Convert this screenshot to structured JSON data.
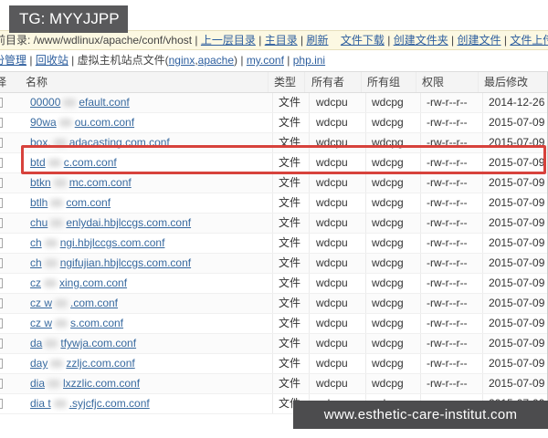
{
  "overlay_top": {
    "label": "TG: MYYJJPP"
  },
  "overlay_bottom": {
    "label": "www.esthetic-care-institut.com"
  },
  "colors": {
    "highlight_red": "#d7423c",
    "toolbar_beige": "#fcf8e2",
    "link_blue": "#2d5e9e",
    "file_link_blue": "#37699f",
    "overlay_gray": "#59595b"
  },
  "toolbar_path": {
    "parts": [
      {
        "text": "前目录: ",
        "link": false
      },
      {
        "text": "/www/wdlinux/apache/conf/vhost",
        "link": false
      },
      {
        "text": " | ",
        "link": false
      },
      {
        "text": "上一层目录",
        "link": true
      },
      {
        "text": " | ",
        "link": false
      },
      {
        "text": "主目录",
        "link": true
      },
      {
        "text": " | ",
        "link": false
      },
      {
        "text": "刷新",
        "link": true
      },
      {
        "text": "    ",
        "link": false
      },
      {
        "text": "文件下载",
        "link": true
      },
      {
        "text": " | ",
        "link": false
      },
      {
        "text": "创建文件夹",
        "link": true
      },
      {
        "text": " | ",
        "link": false
      },
      {
        "text": "创建文件",
        "link": true
      },
      {
        "text": " | ",
        "link": false
      },
      {
        "text": "文件上传",
        "link": true
      }
    ]
  },
  "toolbar_links": {
    "parts": [
      {
        "text": "份管理",
        "link": true
      },
      {
        "text": " | ",
        "link": false
      },
      {
        "text": "回收站",
        "link": true
      },
      {
        "text": " | ",
        "link": false
      },
      {
        "text": "虚拟主机站点文件(",
        "link": false
      },
      {
        "text": "nginx",
        "link": true
      },
      {
        "text": ",",
        "link": false
      },
      {
        "text": "apache",
        "link": true
      },
      {
        "text": ") | ",
        "link": false
      },
      {
        "text": "my.conf",
        "link": true
      },
      {
        "text": " | ",
        "link": false
      },
      {
        "text": "php.ini",
        "link": true
      }
    ]
  },
  "table": {
    "headers": [
      "择",
      "名称",
      "类型",
      "所有者",
      "所有组",
      "权限",
      "最后修改"
    ],
    "rows": [
      {
        "name_pre": "00000",
        "name_post": "efault.conf",
        "type": "文件",
        "owner": "wdcpu",
        "group": "wdcpg",
        "perm": "-rw-r--r--",
        "date": "2014-12-26",
        "highlighted": false
      },
      {
        "name_pre": "90wa",
        "name_post": "ou.com.conf",
        "type": "文件",
        "owner": "wdcpu",
        "group": "wdcpg",
        "perm": "-rw-r--r--",
        "date": "2015-07-09",
        "highlighted": false
      },
      {
        "name_pre": "box.",
        "name_post": "adacasting.com.conf",
        "type": "文件",
        "owner": "wdcpu",
        "group": "wdcpg",
        "perm": "-rw-r--r--",
        "date": "2015-07-09",
        "highlighted": false
      },
      {
        "name_pre": "btd",
        "name_post": "c.com.conf",
        "type": "文件",
        "owner": "wdcpu",
        "group": "wdcpg",
        "perm": "-rw-r--r--",
        "date": "2015-07-09",
        "highlighted": true
      },
      {
        "name_pre": "btkn",
        "name_post": "mc.com.conf",
        "type": "文件",
        "owner": "wdcpu",
        "group": "wdcpg",
        "perm": "-rw-r--r--",
        "date": "2015-07-09",
        "highlighted": false
      },
      {
        "name_pre": "btlh",
        "name_post": "com.conf",
        "type": "文件",
        "owner": "wdcpu",
        "group": "wdcpg",
        "perm": "-rw-r--r--",
        "date": "2015-07-09",
        "highlighted": false
      },
      {
        "name_pre": "chu",
        "name_post": "enlydai.hbjlccgs.com.conf",
        "type": "文件",
        "owner": "wdcpu",
        "group": "wdcpg",
        "perm": "-rw-r--r--",
        "date": "2015-07-09",
        "highlighted": false
      },
      {
        "name_pre": "ch",
        "name_post": "ngi.hbjlccgs.com.conf",
        "type": "文件",
        "owner": "wdcpu",
        "group": "wdcpg",
        "perm": "-rw-r--r--",
        "date": "2015-07-09",
        "highlighted": false
      },
      {
        "name_pre": "ch",
        "name_post": "ngifujian.hbjlccgs.com.conf",
        "type": "文件",
        "owner": "wdcpu",
        "group": "wdcpg",
        "perm": "-rw-r--r--",
        "date": "2015-07-09",
        "highlighted": false
      },
      {
        "name_pre": "cz",
        "name_post": "xing.com.conf",
        "type": "文件",
        "owner": "wdcpu",
        "group": "wdcpg",
        "perm": "-rw-r--r--",
        "date": "2015-07-09",
        "highlighted": false
      },
      {
        "name_pre": "cz w",
        "name_post": ".com.conf",
        "type": "文件",
        "owner": "wdcpu",
        "group": "wdcpg",
        "perm": "-rw-r--r--",
        "date": "2015-07-09",
        "highlighted": false
      },
      {
        "name_pre": "cz w",
        "name_post": "s.com.conf",
        "type": "文件",
        "owner": "wdcpu",
        "group": "wdcpg",
        "perm": "-rw-r--r--",
        "date": "2015-07-09",
        "highlighted": false
      },
      {
        "name_pre": "da",
        "name_post": "tfywja.com.conf",
        "type": "文件",
        "owner": "wdcpu",
        "group": "wdcpg",
        "perm": "-rw-r--r--",
        "date": "2015-07-09",
        "highlighted": false
      },
      {
        "name_pre": "day",
        "name_post": "zzljc.com.conf",
        "type": "文件",
        "owner": "wdcpu",
        "group": "wdcpg",
        "perm": "-rw-r--r--",
        "date": "2015-07-09",
        "highlighted": false
      },
      {
        "name_pre": "dia",
        "name_post": "lxzzlic.com.conf",
        "type": "文件",
        "owner": "wdcpu",
        "group": "wdcpg",
        "perm": "-rw-r--r--",
        "date": "2015-07-09",
        "highlighted": false
      },
      {
        "name_pre": "dia t",
        "name_post": ".syjcfjc.com.conf",
        "type": "文件",
        "owner": "wdcpu",
        "group": "wdcpg",
        "perm": "-rw-r--r--",
        "date": "2015-07-09",
        "highlighted": false
      }
    ]
  }
}
